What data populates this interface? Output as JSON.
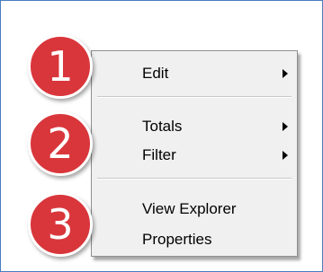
{
  "menu": {
    "items": [
      {
        "label": "Edit",
        "has_submenu": true
      },
      {
        "label": "Totals",
        "has_submenu": true
      },
      {
        "label": "Filter",
        "has_submenu": true
      },
      {
        "label": "View Explorer",
        "has_submenu": false
      },
      {
        "label": "Properties",
        "has_submenu": false
      }
    ]
  },
  "badges": [
    "1",
    "2",
    "3"
  ],
  "colors": {
    "badge": "#d9363b",
    "frame_border": "#4a7cc0",
    "menu_bg": "#f0f0f0"
  }
}
